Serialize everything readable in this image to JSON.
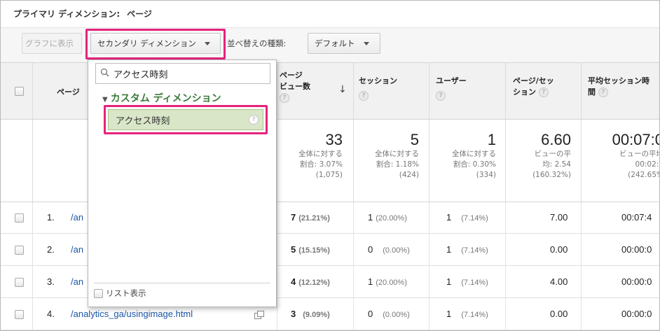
{
  "primary": {
    "label": "プライマリ ディメンション:",
    "value": "ページ"
  },
  "toolbar": {
    "graph_button": "グラフに表示",
    "secondary_dimension_button": "セカンダリ ディメンション",
    "sort_type_label": "並べ替えの種類:",
    "sort_type_value": "デフォルト"
  },
  "headers": {
    "page": "ページ",
    "pageviews": [
      "ページ",
      "ビュー数"
    ],
    "sessions": "セッション",
    "users": "ユーザー",
    "pages_per_session": [
      "ページ/セッ",
      "ション"
    ],
    "avg_duration": [
      "平均セッション時",
      "間"
    ],
    "help": "?"
  },
  "totals": [
    {
      "value": "33",
      "lines": [
        "全体に対する",
        "割合: 3.07%",
        "(1,075)"
      ]
    },
    {
      "value": "5",
      "lines": [
        "全体に対する",
        "割合: 1.18%",
        "(424)"
      ]
    },
    {
      "value": "1",
      "lines": [
        "全体に対する",
        "割合: 0.30%",
        "(334)"
      ]
    },
    {
      "value": "6.60",
      "lines": [
        "ビューの平",
        "均: 2.54",
        "(160.32%)"
      ]
    },
    {
      "value": "00:07:0",
      "lines": [
        "ビューの平均",
        "00:02:0",
        "(242.65%"
      ]
    }
  ],
  "rows": [
    {
      "num": "1.",
      "page": "/an",
      "pv": "7",
      "pv_pct": "(21.21%)",
      "ses": "1",
      "ses_pct": "(20.00%)",
      "usr": "1",
      "usr_pct": "(7.14%)",
      "pps": "7.00",
      "dur": "00:07:4"
    },
    {
      "num": "2.",
      "page": "/an",
      "pv": "5",
      "pv_pct": "(15.15%)",
      "ses": "0",
      "ses_pct": "(0.00%)",
      "usr": "1",
      "usr_pct": "(7.14%)",
      "pps": "0.00",
      "dur": "00:00:0"
    },
    {
      "num": "3.",
      "page": "/an",
      "pv": "4",
      "pv_pct": "(12.12%)",
      "ses": "1",
      "ses_pct": "(20.00%)",
      "usr": "1",
      "usr_pct": "(7.14%)",
      "pps": "4.00",
      "dur": "00:00:0"
    },
    {
      "num": "4.",
      "page": "/analytics_ga/usingimage.html",
      "pv": "3",
      "pv_pct": "(9.09%)",
      "ses": "0",
      "ses_pct": "(0.00%)",
      "usr": "1",
      "usr_pct": "(7.14%)",
      "pps": "0.00",
      "dur": "00:00:0"
    }
  ],
  "dropdown": {
    "search_value": "アクセス時刻",
    "category": "カスタム ディメンション",
    "item": "アクセス時刻",
    "list_view": "リスト表示"
  },
  "colors": {
    "highlight": "#e5237a",
    "link": "#1a56a6",
    "category": "#3b7a3b",
    "item_bg": "#d9e6c8"
  }
}
